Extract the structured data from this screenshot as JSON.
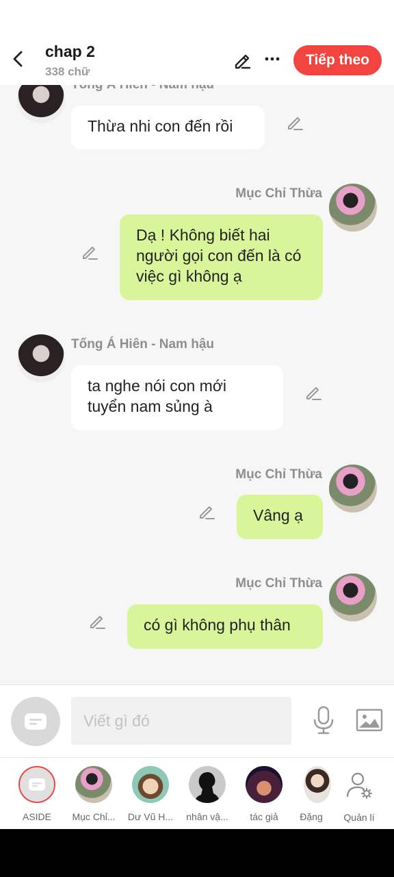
{
  "header": {
    "title": "chap 2",
    "word_count": "338 chữ",
    "next_label": "Tiếp theo"
  },
  "messages": [
    {
      "side": "left",
      "sender": "Tống Á Hiên - Nam hậu",
      "text": "Thừa nhi con đến rồi"
    },
    {
      "side": "right",
      "sender": "Mục Chỉ Thừa",
      "text": "Dạ ! Không biết hai người gọi con đến là có việc gì không ạ"
    },
    {
      "side": "left",
      "sender": "Tống Á Hiên - Nam hậu",
      "text": "ta nghe nói con mới tuyển nam sủng à"
    },
    {
      "side": "right",
      "sender": "Mục Chỉ Thừa",
      "text": "Vâng ạ"
    },
    {
      "side": "right",
      "sender": "Mục Chỉ Thừa",
      "text": "có gì không phụ thân"
    }
  ],
  "composer": {
    "placeholder": "Viết gì đó"
  },
  "characters": [
    {
      "label": "ASIDE"
    },
    {
      "label": "Mục Chỉ..."
    },
    {
      "label": "Dư Vũ H..."
    },
    {
      "label": "nhân vậ..."
    },
    {
      "label": "tác giả"
    },
    {
      "label": "Đặng"
    }
  ],
  "manage_label": "Quản lí",
  "colors": {
    "accent": "#f2453f",
    "right_bubble": "#d8f59a",
    "left_bubble": "#ffffff"
  }
}
